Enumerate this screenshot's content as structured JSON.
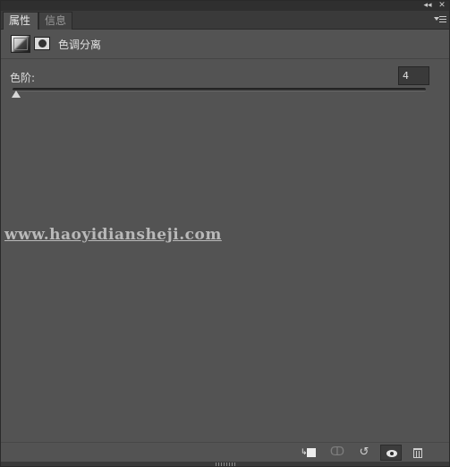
{
  "window": {
    "collapse_label": "◂◂",
    "close_label": "✕"
  },
  "tabs": [
    {
      "label": "属性",
      "active": true
    },
    {
      "label": "信息",
      "active": false
    }
  ],
  "header": {
    "title": "色调分离",
    "adjustment_icon": "posterize-adjustment-icon",
    "mask_icon": "layer-mask-icon"
  },
  "levels": {
    "label": "色阶:",
    "value": "4",
    "slider_fraction": 0
  },
  "watermark": {
    "text": "www.haoyidiansheji.com"
  },
  "footer": {
    "icons": [
      "clip-to-layer-icon",
      "view-previous-state-icon",
      "reset-icon",
      "visibility-eye-icon",
      "delete-icon"
    ],
    "prev_state_glyph": "ↀ",
    "reset_glyph": "↺"
  },
  "colors": {
    "panel_bg": "#535353",
    "tabbar_bg": "#3a3a3a",
    "text": "#dcdcdc"
  }
}
